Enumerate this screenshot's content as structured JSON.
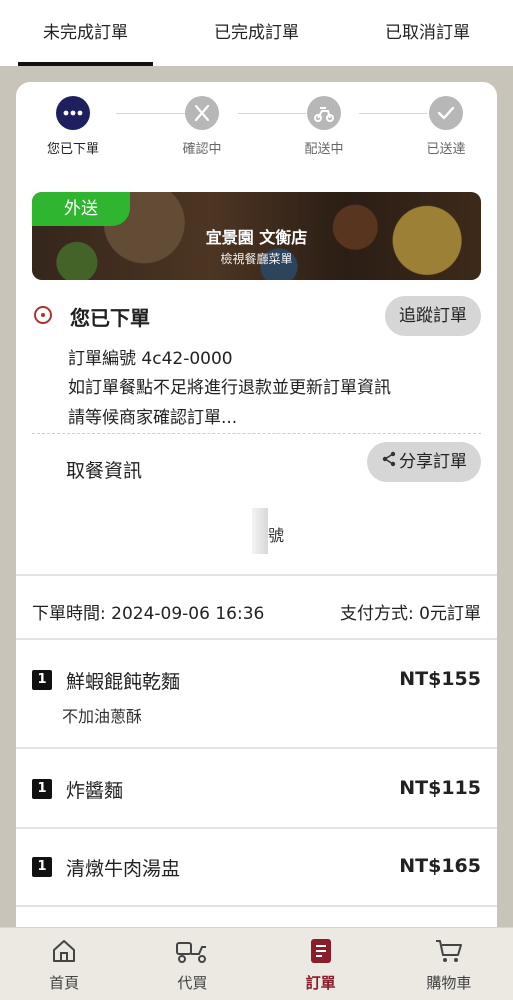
{
  "tabs": [
    "未完成訂單",
    "已完成訂單",
    "已取消訂單"
  ],
  "progress": {
    "steps": [
      "您已下單",
      "確認中",
      "配送中",
      "已送達"
    ],
    "current_index": 0
  },
  "store": {
    "badge": "外送",
    "name": "宜景園 文衡店",
    "menu_link": "檢視餐廳菜單"
  },
  "status": {
    "title": "您已下單",
    "track_button": "追蹤訂單",
    "order_number": "訂單編號 4c42-0000",
    "message_1": "如訂單餐點不足將進行退款並更新訂單資訊",
    "message_2": "請等候商家確認訂單..."
  },
  "pickup": {
    "title": "取餐資訊",
    "share_button": "分享訂單",
    "number_suffix": "號"
  },
  "meta": {
    "order_time": "下單時間: 2024-09-06 16:36",
    "payment": "支付方式: 0元訂單"
  },
  "items": [
    {
      "qty": "1",
      "name": "鮮蝦餛飩乾麵",
      "price": "NT$155",
      "note": "不加油蔥酥"
    },
    {
      "qty": "1",
      "name": "炸醬麵",
      "price": "NT$115",
      "note": ""
    },
    {
      "qty": "1",
      "name": "清燉牛肉湯盅",
      "price": "NT$165",
      "note": ""
    }
  ],
  "bottom_nav": [
    {
      "label": "首頁",
      "icon": "home-icon"
    },
    {
      "label": "代買",
      "icon": "delivery-scooter-icon"
    },
    {
      "label": "訂單",
      "icon": "order-document-icon"
    },
    {
      "label": "購物車",
      "icon": "shopping-cart-icon"
    }
  ],
  "bottom_nav_active_index": 2,
  "colors": {
    "current_step": "#1d1f5e",
    "delivery_badge": "#2fb52f",
    "status_icon": "#b0332a",
    "nav_active": "#8a1c2b"
  }
}
